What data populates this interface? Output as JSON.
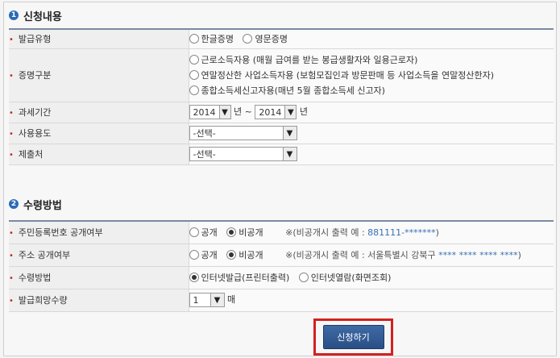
{
  "section1": {
    "number": "1",
    "title": "신청내용"
  },
  "section2": {
    "number": "2",
    "title": "수령방법"
  },
  "fields": {
    "issue_type": {
      "label": "발급유형",
      "options": [
        "한글증명",
        "영문증명"
      ]
    },
    "cert_type": {
      "label": "증명구분",
      "options": [
        "근로소득자용 (매월 급여를 받는 봉급생활자와 일용근로자)",
        "연말정산한 사업소득자용 (보험모집인과 방문판매 등 사업소득을 연말정산한자)",
        "종합소득세신고자용(매년 5월 종합소득세 신고자)"
      ]
    },
    "tax_period": {
      "label": "과세기간",
      "from_year": "2014",
      "year_unit": "년",
      "separator": "~",
      "to_year": "2014"
    },
    "purpose": {
      "label": "사용용도",
      "selected": "-선택-"
    },
    "submit_to": {
      "label": "제출처",
      "selected": "-선택-"
    },
    "rrn_disclosure": {
      "label": "주민등록번호 공개여부",
      "options": [
        "공개",
        "비공개"
      ],
      "note_prefix": "※(비공개시 출력 예 : ",
      "note_example": "881111-*******",
      "note_suffix": ")"
    },
    "addr_disclosure": {
      "label": "주소 공개여부",
      "options": [
        "공개",
        "비공개"
      ],
      "note_prefix": "※(비공개시 출력 예 : 서울특별시 강북구 ",
      "note_example": "**** **** **** ****",
      "note_suffix": ")"
    },
    "receive_method": {
      "label": "수령방법",
      "options": [
        "인터넷발급(프린터출력)",
        "인터넷열람(화면조회)"
      ]
    },
    "quantity": {
      "label": "발급희망수량",
      "selected": "1",
      "unit": "매"
    }
  },
  "submit": {
    "label": "신청하기"
  },
  "colors": {
    "accent": "#2a6bb8",
    "highlight": "#d42020",
    "button": "#2a4f86"
  }
}
